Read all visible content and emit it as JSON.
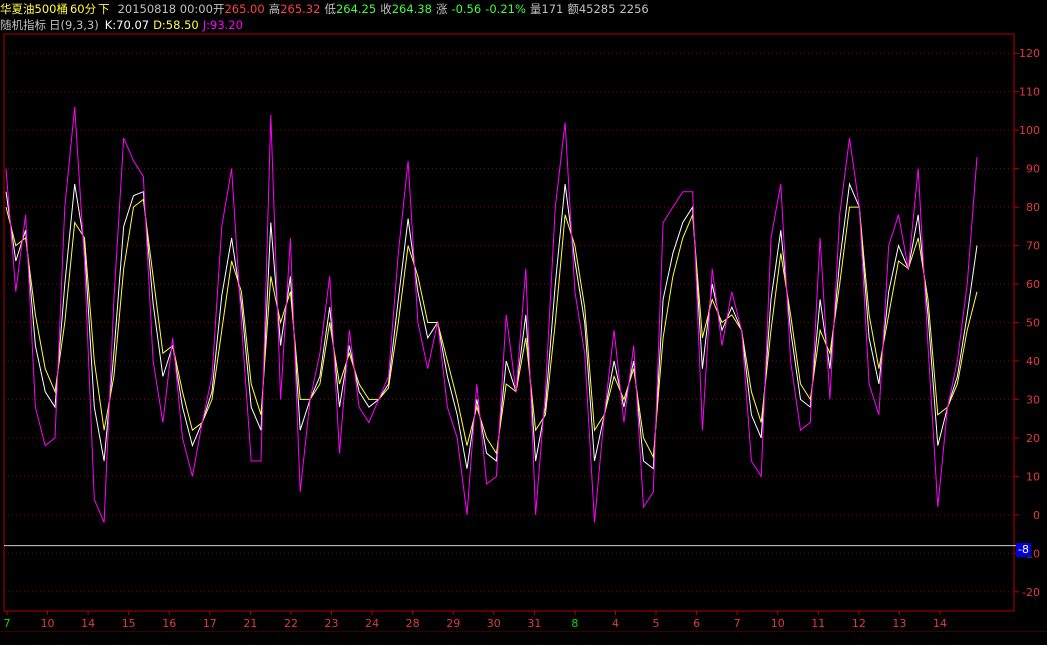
{
  "header": {
    "instrument": "华夏油500桶",
    "period": "60分",
    "direction": "下",
    "date_time": "20150818 00:00",
    "open_label": "开",
    "open_value": "265.00",
    "high_label": "高",
    "high_value": "265.32",
    "low_label": "低",
    "low_value": "264.25",
    "close_label": "收",
    "close_value": "264.38",
    "change_label": "涨",
    "change_value": "-0.56",
    "change_pct": "-0.21%",
    "volume_label": "量",
    "volume_value": "171",
    "amount_label": "额",
    "amount_value": "45285",
    "extra_value": "2256"
  },
  "indicator": {
    "name": "随机指标",
    "period_label": "日",
    "params": "(9,3,3)",
    "k_label": "K:70.07",
    "d_label": "D:58.50",
    "j_label": "J:93.20"
  },
  "cursor_value": "-8",
  "colors": {
    "k": "#ffffff",
    "d": "#ffff40",
    "j": "#ff00ff",
    "axis": "#b40000",
    "grid": "#8a0000",
    "tick": "#e23a3a",
    "green": "#00e000"
  },
  "chart_data": {
    "type": "line",
    "ylim": [
      -25,
      125
    ],
    "yticks": [
      120,
      110,
      100,
      90,
      80,
      70,
      60,
      50,
      40,
      30,
      20,
      10,
      0,
      -10,
      -20
    ],
    "xtick_labels": [
      {
        "label": "7",
        "color": "green"
      },
      {
        "label": "10",
        "color": "red"
      },
      {
        "label": "14",
        "color": "red"
      },
      {
        "label": "15",
        "color": "red"
      },
      {
        "label": "16",
        "color": "red"
      },
      {
        "label": "17",
        "color": "red"
      },
      {
        "label": "21",
        "color": "red"
      },
      {
        "label": "22",
        "color": "red"
      },
      {
        "label": "23",
        "color": "red"
      },
      {
        "label": "24",
        "color": "red"
      },
      {
        "label": "28",
        "color": "red"
      },
      {
        "label": "29",
        "color": "red"
      },
      {
        "label": "30",
        "color": "red"
      },
      {
        "label": "31",
        "color": "red"
      },
      {
        "label": "8",
        "color": "green"
      },
      {
        "label": "4",
        "color": "red"
      },
      {
        "label": "5",
        "color": "red"
      },
      {
        "label": "6",
        "color": "red"
      },
      {
        "label": "7",
        "color": "red"
      },
      {
        "label": "10",
        "color": "red"
      },
      {
        "label": "11",
        "color": "red"
      },
      {
        "label": "12",
        "color": "red"
      },
      {
        "label": "13",
        "color": "red"
      },
      {
        "label": "14",
        "color": "red"
      }
    ],
    "cursor_y": -8,
    "series": [
      {
        "name": "K",
        "color": "#ffffff",
        "values": [
          84,
          66,
          74,
          44,
          32,
          28,
          60,
          86,
          70,
          28,
          14,
          42,
          75,
          83,
          84,
          55,
          36,
          44,
          28,
          18,
          24,
          32,
          57,
          72,
          55,
          28,
          22,
          76,
          44,
          62,
          22,
          30,
          36,
          54,
          28,
          44,
          32,
          28,
          30,
          34,
          56,
          77,
          58,
          46,
          50,
          36,
          26,
          12,
          30,
          16,
          14,
          40,
          32,
          52,
          14,
          28,
          60,
          86,
          66,
          50,
          14,
          26,
          40,
          28,
          40,
          14,
          12,
          56,
          68,
          76,
          80,
          38,
          60,
          48,
          54,
          48,
          26,
          20,
          56,
          74,
          48,
          30,
          28,
          56,
          38,
          66,
          86,
          80,
          46,
          34,
          58,
          70,
          64,
          78,
          52,
          18,
          28,
          36,
          52,
          70
        ]
      },
      {
        "name": "D",
        "color": "#ffff40",
        "values": [
          80,
          70,
          72,
          52,
          38,
          32,
          50,
          76,
          72,
          40,
          22,
          36,
          64,
          80,
          82,
          62,
          42,
          44,
          32,
          22,
          24,
          30,
          48,
          66,
          58,
          34,
          26,
          62,
          50,
          58,
          30,
          30,
          34,
          50,
          34,
          42,
          34,
          30,
          30,
          33,
          50,
          70,
          62,
          50,
          50,
          40,
          30,
          18,
          28,
          20,
          16,
          34,
          32,
          46,
          22,
          26,
          50,
          78,
          70,
          54,
          22,
          26,
          36,
          30,
          38,
          20,
          15,
          46,
          62,
          72,
          78,
          46,
          56,
          50,
          52,
          48,
          32,
          24,
          48,
          68,
          52,
          34,
          30,
          48,
          42,
          60,
          80,
          80,
          52,
          38,
          52,
          66,
          64,
          72,
          56,
          26,
          28,
          34,
          48,
          58
        ]
      },
      {
        "name": "J",
        "color": "#ff00ff",
        "values": [
          90,
          58,
          78,
          28,
          18,
          20,
          80,
          106,
          66,
          4,
          -2,
          56,
          98,
          92,
          88,
          40,
          24,
          46,
          20,
          10,
          24,
          36,
          75,
          90,
          50,
          14,
          14,
          104,
          30,
          72,
          6,
          30,
          42,
          62,
          16,
          48,
          28,
          24,
          30,
          36,
          68,
          92,
          50,
          38,
          50,
          28,
          20,
          0,
          34,
          8,
          10,
          52,
          32,
          64,
          0,
          32,
          80,
          102,
          58,
          42,
          -2,
          26,
          48,
          24,
          44,
          2,
          6,
          76,
          80,
          84,
          84,
          22,
          64,
          44,
          58,
          48,
          14,
          10,
          72,
          86,
          40,
          22,
          24,
          72,
          30,
          78,
          98,
          80,
          34,
          26,
          70,
          78,
          64,
          90,
          44,
          2,
          28,
          40,
          60,
          93
        ]
      }
    ]
  }
}
